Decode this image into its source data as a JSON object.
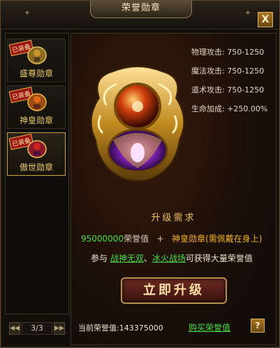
{
  "window": {
    "title": "荣誉勋章",
    "close_label": "X"
  },
  "medals": [
    {
      "name": "盛尊勋章",
      "tag": "已装备",
      "active": false
    },
    {
      "name": "神皇勋章",
      "tag": "已装备",
      "active": false
    },
    {
      "name": "傲世勋章",
      "tag": "已装备",
      "active": true
    }
  ],
  "pager": {
    "prev_label": "◀◀",
    "next_label": "▶▶",
    "page_text": "3/3"
  },
  "stats": [
    {
      "label": "物理攻击:",
      "value": "750-1250"
    },
    {
      "label": "魔法攻击:",
      "value": "750-1250"
    },
    {
      "label": "道术攻击:",
      "value": "750-1250"
    },
    {
      "label": "生命加成:",
      "value": "+250.00%"
    }
  ],
  "requirements": {
    "title": "升级需求",
    "honor_amount": "95000000",
    "honor_unit": "荣誉值",
    "plus": "+",
    "required_medal": "神皇勋章(需佩戴在身上)",
    "participate_prefix": "参与",
    "activity_1": "战神无双",
    "separator": "、",
    "activity_2": "冰火战场",
    "participate_suffix": "可获得大量荣誉值"
  },
  "upgrade_button": "立即升级",
  "footer": {
    "current_label": "当前荣誉值:",
    "current_value": "143375000",
    "buy_label": "购买荣誉值",
    "help_label": "?"
  },
  "colors": {
    "accent_gold": "#e8c060",
    "link_green": "#4bdc45",
    "tag_red": "#9b1414"
  }
}
